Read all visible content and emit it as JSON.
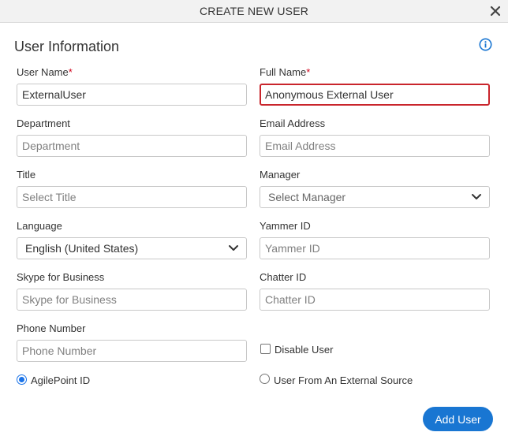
{
  "dialog": {
    "title": "CREATE NEW USER",
    "close_icon": "close-icon",
    "section_title": "User Information",
    "info_icon": "info-icon"
  },
  "fields": {
    "user_name": {
      "label": "User Name",
      "required": "*",
      "value": "ExternalUser",
      "placeholder": ""
    },
    "full_name": {
      "label": "Full Name",
      "required": "*",
      "value": "Anonymous External User",
      "placeholder": ""
    },
    "department": {
      "label": "Department",
      "value": "",
      "placeholder": "Department"
    },
    "email": {
      "label": "Email Address",
      "value": "",
      "placeholder": "Email Address"
    },
    "title": {
      "label": "Title",
      "value": "",
      "placeholder": "Select Title"
    },
    "manager": {
      "label": "Manager",
      "selected": "Select Manager"
    },
    "language": {
      "label": "Language",
      "selected": "English (United States)"
    },
    "yammer": {
      "label": "Yammer ID",
      "value": "",
      "placeholder": "Yammer ID"
    },
    "skype": {
      "label": "Skype for Business",
      "value": "",
      "placeholder": "Skype for Business"
    },
    "chatter": {
      "label": "Chatter ID",
      "value": "",
      "placeholder": "Chatter ID"
    },
    "phone": {
      "label": "Phone Number",
      "value": "",
      "placeholder": "Phone Number"
    }
  },
  "options": {
    "disable_user": {
      "label": "Disable User",
      "checked": false
    },
    "agilepoint_id": {
      "label": "AgilePoint ID",
      "checked": true
    },
    "external_source": {
      "label": "User From An External Source",
      "checked": false
    }
  },
  "actions": {
    "add_user_label": "Add User"
  },
  "colors": {
    "accent": "#1976d2",
    "highlight_border": "#c9252c",
    "required": "#d0021b"
  }
}
